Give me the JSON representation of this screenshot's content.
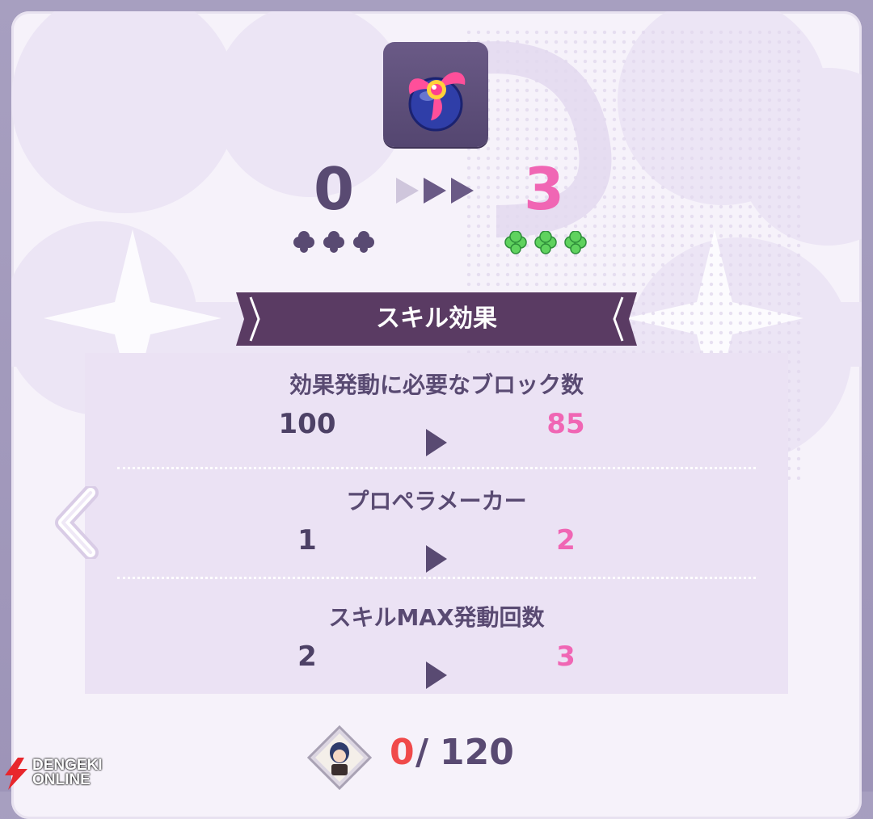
{
  "skill": {
    "icon": "propeller-ball-icon",
    "level_from": "0",
    "level_to": "3",
    "clovers_from_count": 3,
    "clovers_to_count": 3
  },
  "section_title": "スキル効果",
  "effects": [
    {
      "title": "効果発動に必要なブロック数",
      "from": "100",
      "to": "85"
    },
    {
      "title": "プロペラメーカー",
      "from": "1",
      "to": "2"
    },
    {
      "title": "スキルMAX発動回数",
      "from": "2",
      "to": "3"
    }
  ],
  "footer": {
    "current": "0",
    "separator": "/",
    "total": "120"
  },
  "watermark": {
    "line1": "DENGEKI",
    "line2": "ONLINE"
  },
  "colors": {
    "accent_pink": "#f066b4",
    "text_purple": "#594a72",
    "ribbon": "#5a3b63",
    "count_red": "#f04a4a"
  }
}
